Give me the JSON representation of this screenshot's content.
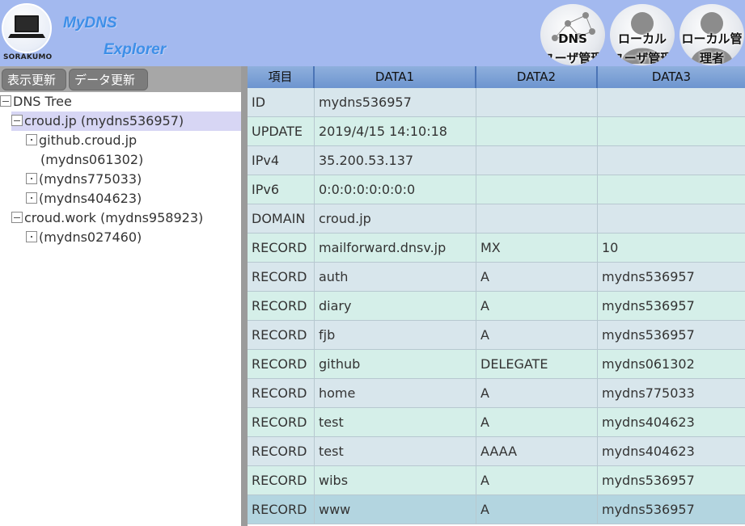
{
  "header": {
    "logo_text": "SORAKUMO",
    "title_line1": "MyDNS",
    "title_line2": "Explorer",
    "buttons": [
      {
        "line1": "DNS",
        "line2": "ユーザ管理"
      },
      {
        "line1": "ローカル",
        "line2": "ユーザ管理"
      },
      {
        "line1": "ローカル管",
        "line2": "理者"
      }
    ]
  },
  "toolbar": {
    "refresh_view": "表示更新",
    "refresh_data": "データ更新"
  },
  "tree": [
    {
      "label": "DNS Tree"
    },
    {
      "label": "croud.jp (mydns536957)"
    },
    {
      "label": "github.croud.jp"
    },
    {
      "label": "(mydns061302)"
    },
    {
      "label": "(mydns775033)"
    },
    {
      "label": "(mydns404623)"
    },
    {
      "label": "croud.work (mydns958923)"
    },
    {
      "label": "(mydns027460)"
    }
  ],
  "table": {
    "headers": [
      "項目",
      "DATA1",
      "DATA2",
      "DATA3"
    ],
    "rows": [
      [
        "ID",
        "mydns536957",
        "",
        ""
      ],
      [
        "UPDATE",
        "2019/4/15 14:10:18",
        "",
        ""
      ],
      [
        "IPv4",
        "35.200.53.137",
        "",
        ""
      ],
      [
        "IPv6",
        "0:0:0:0:0:0:0:0",
        "",
        ""
      ],
      [
        "DOMAIN",
        "croud.jp",
        "",
        ""
      ],
      [
        "RECORD",
        "mailforward.dnsv.jp",
        "MX",
        "10"
      ],
      [
        "RECORD",
        "auth",
        "A",
        "mydns536957"
      ],
      [
        "RECORD",
        "diary",
        "A",
        "mydns536957"
      ],
      [
        "RECORD",
        "fjb",
        "A",
        "mydns536957"
      ],
      [
        "RECORD",
        "github",
        "DELEGATE",
        "mydns061302"
      ],
      [
        "RECORD",
        "home",
        "A",
        "mydns775033"
      ],
      [
        "RECORD",
        "test",
        "A",
        "mydns404623"
      ],
      [
        "RECORD",
        "test",
        "AAAA",
        "mydns404623"
      ],
      [
        "RECORD",
        "wibs",
        "A",
        "mydns536957"
      ],
      [
        "RECORD",
        "www",
        "A",
        "mydns536957"
      ]
    ]
  },
  "colors": {
    "header_bg": "#a3b9ef",
    "title_blue": "#3d8fe8",
    "tree_selected": "#d7d6f4",
    "row_odd": "#d8e6ec",
    "row_even": "#d5efe9",
    "row_highlight": "#b3d5e0"
  },
  "icons": {
    "logo": "laptop-icon",
    "dns_user_admin": "network-graph-icon",
    "local_user_admin": "person-icon",
    "local_admin": "person-icon"
  }
}
